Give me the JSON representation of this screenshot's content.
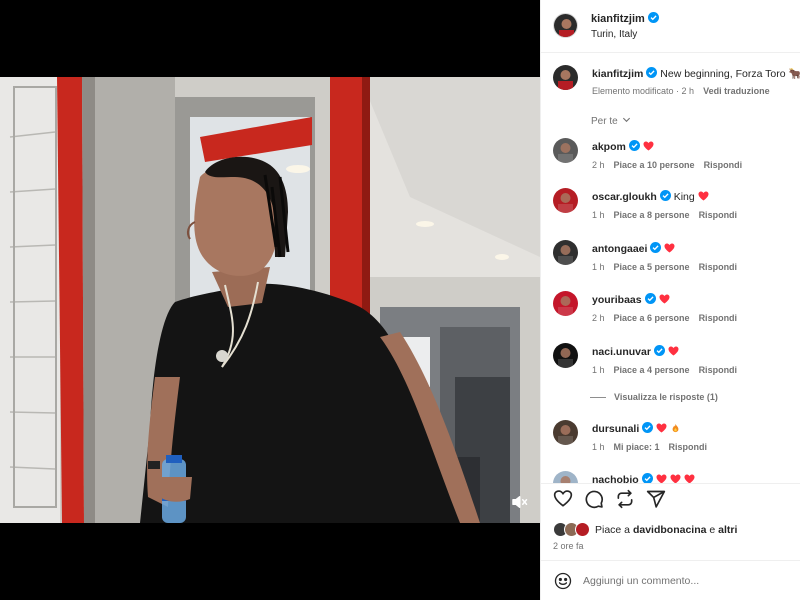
{
  "post": {
    "username": "kianfitzjim",
    "location": "Turin, Italy",
    "caption": "New beginning, Forza Toro",
    "caption_emoji": "🐂",
    "caption_meta": "Elemento modificato · 2 h",
    "translate_label": "Vedi traduzione",
    "sort_label": "Per te"
  },
  "comments": [
    {
      "username": "akpom",
      "text": "",
      "hearts": 1,
      "fire": false,
      "time": "2 h",
      "likes": "Piace a 10 persone",
      "reply": "Rispondi",
      "avatar_color": "#5a5a5a"
    },
    {
      "username": "oscar.gloukh",
      "text": "King",
      "hearts": 1,
      "fire": false,
      "time": "1 h",
      "likes": "Piace a 8 persone",
      "reply": "Rispondi",
      "avatar_color": "#b51d24"
    },
    {
      "username": "antongaaei",
      "text": "",
      "hearts": 1,
      "fire": false,
      "time": "1 h",
      "likes": "Piace a 5 persone",
      "reply": "Rispondi",
      "avatar_color": "#2f2f2f"
    },
    {
      "username": "youribaas",
      "text": "",
      "hearts": 1,
      "fire": false,
      "time": "2 h",
      "likes": "Piace a 6 persone",
      "reply": "Rispondi",
      "avatar_color": "#c4162a"
    },
    {
      "username": "naci.unuvar",
      "text": "",
      "hearts": 1,
      "fire": false,
      "time": "1 h",
      "likes": "Piace a 4 persone",
      "reply": "Rispondi",
      "avatar_color": "#111111",
      "replies": "Visualizza le risposte (1)"
    },
    {
      "username": "dursunali",
      "text": "",
      "hearts": 1,
      "fire": true,
      "time": "1 h",
      "likes": "Mi piace: 1",
      "reply": "Rispondi",
      "avatar_color": "#4a3b30"
    },
    {
      "username": "nachobio",
      "text": "",
      "hearts": 3,
      "fire": false,
      "time": "",
      "likes": "",
      "reply": "",
      "avatar_color": "#9fb4c8"
    }
  ],
  "footer": {
    "likes_prefix": "Piace a",
    "likes_user": "davidbonacina",
    "likes_conj": "e",
    "likes_suffix": "altri",
    "time_ago": "2 ore fa",
    "comment_placeholder": "Aggiungi un commento..."
  },
  "colors": {
    "verified": "#0095f6",
    "heart": "#ff3040",
    "text": "#262626",
    "muted": "#737373",
    "frame_red": "#c8281e"
  },
  "icons": [
    "like-icon",
    "comment-icon",
    "share-icon",
    "send-icon",
    "emoji-icon",
    "mute-icon",
    "verified-icon",
    "chevron-down-icon"
  ]
}
